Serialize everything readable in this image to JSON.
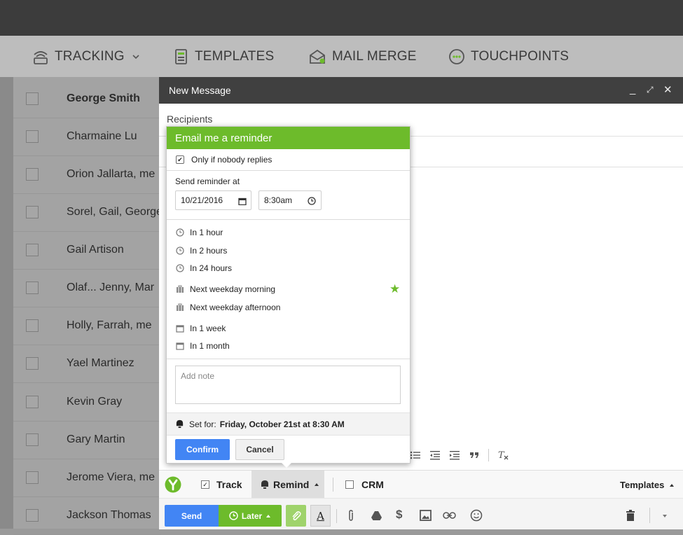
{
  "nav": {
    "tracking": "TRACKING",
    "templates": "TEMPLATES",
    "mail_merge": "MAIL MERGE",
    "touchpoints": "TOUCHPOINTS"
  },
  "inbox": {
    "rows": [
      {
        "sender": "George Smith"
      },
      {
        "sender": "Charmaine Lu"
      },
      {
        "sender": "Orion Jallarta, me"
      },
      {
        "sender": "Sorel, Gail, George"
      },
      {
        "sender": "Gail Artison"
      },
      {
        "sender": "Olaf... Jenny, Mar"
      },
      {
        "sender": "Holly, Farrah, me"
      },
      {
        "sender": "Yael Martinez"
      },
      {
        "sender": "Kevin Gray"
      },
      {
        "sender": "Gary Martin"
      },
      {
        "sender": "Jerome Viera, me"
      },
      {
        "sender": "Jackson Thomas"
      }
    ]
  },
  "compose": {
    "title": "New Message",
    "minimize": "_",
    "expand": "⤢",
    "close": "✕",
    "recipients_label": "Recipients",
    "track_label": "Track",
    "remind_label": "Remind",
    "crm_label": "CRM",
    "templates_label": "Templates",
    "send_label": "Send",
    "later_label": "Later",
    "text_color": "A",
    "dollar": "$"
  },
  "reminder": {
    "header": "Email me a reminder",
    "only_if_no_reply": "Only if nobody replies",
    "send_at_label": "Send reminder at",
    "date_value": "10/21/2016",
    "time_value": "8:30am",
    "options": [
      {
        "label": "In 1 hour",
        "icon": "clock-icon"
      },
      {
        "label": "In 2 hours",
        "icon": "clock-icon"
      },
      {
        "label": "In 24 hours",
        "icon": "clock-icon"
      },
      {
        "label": "Next weekday morning",
        "icon": "briefcase-icon"
      },
      {
        "label": "Next weekday afternoon",
        "icon": "briefcase-icon"
      },
      {
        "label": "In 1 week",
        "icon": "calendar-icon"
      },
      {
        "label": "In 1 month",
        "icon": "calendar-icon"
      }
    ],
    "star": "★",
    "note_placeholder": "Add note",
    "set_for_label": "Set for:",
    "set_for_value": "Friday, October 21st at 8:30 AM",
    "confirm": "Confirm",
    "cancel": "Cancel"
  },
  "colors": {
    "accent_green": "#6dbb2b",
    "send_blue": "#4285f4",
    "header_dark": "#404040"
  }
}
